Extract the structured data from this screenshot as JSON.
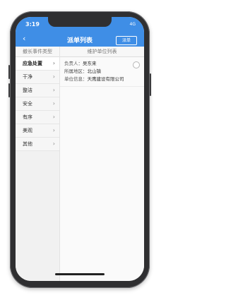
{
  "status_bar": {
    "time": "3:19",
    "indicators": "4G"
  },
  "header": {
    "title": "派单列表",
    "action": "派单"
  },
  "left_column": {
    "heading": "撤长事件类型",
    "items": [
      {
        "label": "应急处置"
      },
      {
        "label": "干净"
      },
      {
        "label": "整洁"
      },
      {
        "label": "安全"
      },
      {
        "label": "有序"
      },
      {
        "label": "美观"
      },
      {
        "label": "其他"
      }
    ]
  },
  "right_column": {
    "heading": "维护单位列表",
    "cards": [
      {
        "person_label": "负责人：",
        "person_value": "吴东来",
        "area_label": "所属地区：",
        "area_value": "北山镇",
        "unit_label": "单位信息：",
        "unit_value": "天鹰建设有限公司"
      }
    ]
  },
  "colors": {
    "accent": "#3f8ee6",
    "frame": "#2f2f31",
    "left_bg": "#f1f1f1"
  },
  "icons": {
    "back": "back-icon",
    "chevron": "chevron-right-icon",
    "radio": "radio-icon"
  }
}
